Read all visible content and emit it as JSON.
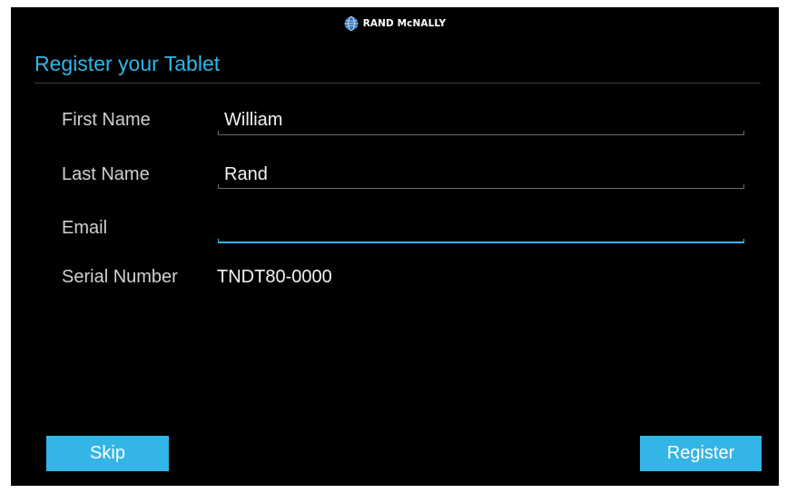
{
  "header": {
    "brand_name": "RAND McNALLY",
    "brand_icon": "globe-logo-icon",
    "brand_color": "#33b5e5"
  },
  "form": {
    "title": "Register your Tablet",
    "accent_color": "#33b5e5",
    "first_name": {
      "label": "First Name",
      "value": "William"
    },
    "last_name": {
      "label": "Last Name",
      "value": "Rand"
    },
    "email": {
      "label": "Email",
      "value": "",
      "placeholder": ""
    },
    "serial_number": {
      "label": "Serial Number",
      "value": "TNDT80-0000"
    }
  },
  "actions": {
    "skip_label": "Skip",
    "register_label": "Register"
  }
}
